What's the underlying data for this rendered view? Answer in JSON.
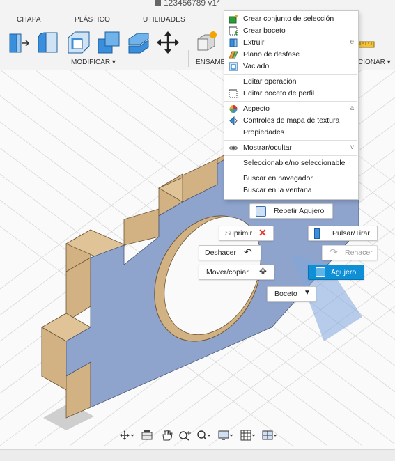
{
  "window": {
    "title": "123456789 v1*"
  },
  "ribbon": {
    "tabs": [
      "CHAPA",
      "PLÁSTICO",
      "UTILIDADES"
    ],
    "groups": {
      "modify": "MODIFICAR ▾",
      "assemble": "ENSAMB",
      "inspect": "CIONAR ▾"
    },
    "tools": [
      {
        "name": "pulsar-tirar-icon"
      },
      {
        "name": "empalme-icon"
      },
      {
        "name": "vaciado-icon"
      },
      {
        "name": "combinar-icon"
      },
      {
        "name": "desfase-caras-icon"
      },
      {
        "name": "mover-icon"
      },
      {
        "name": "nuevo-componente-icon"
      },
      {
        "name": "medir-icon"
      }
    ]
  },
  "context_menu": {
    "items": [
      {
        "label": "Crear conjunto de selección",
        "icon": "selection-set-icon"
      },
      {
        "label": "Crear boceto",
        "icon": "sketch-icon"
      },
      {
        "label": "Extruir",
        "icon": "extrude-icon",
        "shortcut": "e"
      },
      {
        "label": "Plano de desfase",
        "icon": "offset-plane-icon"
      },
      {
        "label": "Vaciado",
        "icon": "shell-icon"
      },
      {
        "label": "Editar operación",
        "icon": ""
      },
      {
        "label": "Editar boceto de perfil",
        "icon": "edit-sketch-icon"
      },
      {
        "label": "Aspecto",
        "icon": "appearance-icon",
        "shortcut": "a"
      },
      {
        "label": "Controles de mapa de textura",
        "icon": "texture-map-icon"
      },
      {
        "label": "Propiedades",
        "icon": ""
      },
      {
        "label": "Mostrar/ocultar",
        "icon": "eye-icon",
        "shortcut": "v"
      },
      {
        "label": "Seleccionable/no seleccionable",
        "icon": ""
      },
      {
        "label": "Buscar en navegador",
        "icon": ""
      },
      {
        "label": "Buscar en la ventana",
        "icon": ""
      }
    ]
  },
  "marking_menu": {
    "repeat": "Repetir Agujero",
    "delete": "Suprimir",
    "press_pull": "Pulsar/Tirar",
    "undo": "Deshacer",
    "redo": "Rehacer",
    "move": "Mover/copiar",
    "hole": "Agujero",
    "sketch": "Boceto"
  },
  "navbar": {
    "tools": [
      "orbit-icon",
      "look-at-icon",
      "pan-icon",
      "zoom-icon",
      "fit-icon",
      "display-settings-icon",
      "grid-icon",
      "viewports-icon"
    ]
  },
  "colors": {
    "face_front": "#8ea4cc",
    "face_wood": "#d2b182",
    "accent": "#0f8fd6",
    "menu_bg": "#ffffff"
  }
}
